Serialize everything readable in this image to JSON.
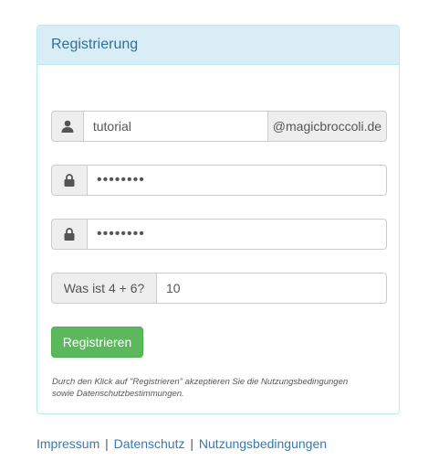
{
  "panel": {
    "title": "Registrierung"
  },
  "form": {
    "username": {
      "icon": "user-icon",
      "value": "tutorial",
      "domain_suffix": "@magicbroccoli.de"
    },
    "password": {
      "icon": "lock-icon",
      "value": "••••••••"
    },
    "password_confirm": {
      "icon": "lock-icon",
      "value": "••••••••"
    },
    "captcha": {
      "question": "Was ist 4 + 6?",
      "value": "10"
    },
    "submit_label": "Registrieren",
    "terms_line1": "Durch den Klick auf \"Registrieren\" akzeptieren Sie die Nutzungsbedingungen",
    "terms_line2": "sowie Datenschutzbestimmungen."
  },
  "footer": {
    "links": [
      "Impressum",
      "Datenschutz",
      "Nutzungsbedingungen"
    ],
    "separator": "|"
  },
  "colors": {
    "panel_heading_bg": "#d9edf7",
    "panel_border": "#bce8f1",
    "panel_title": "#31708f",
    "button_bg": "#5cb85c",
    "link": "#337ab7"
  }
}
